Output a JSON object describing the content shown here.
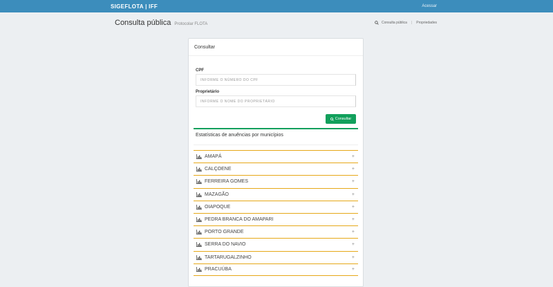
{
  "topbar": {
    "brand": "SIGEFLOTA | IFF",
    "link": "Acessar"
  },
  "header": {
    "title": "Consulta pública",
    "subtitle": "Protocolar FLOTA",
    "links": [
      "Consulta pública",
      "Propriedades"
    ]
  },
  "card": {
    "title": "Consultar",
    "cpf_label": "CPF",
    "cpf_placeholder": "INFORME O NÚMERO DO CPF",
    "owner_label": "Proprietário",
    "owner_placeholder": "INFORME O NOME DO PROPRIETÁRIO",
    "button_label": "Consultar"
  },
  "stats": {
    "title": "Estatísticas de anuências por municípios",
    "municipalities": [
      "AMAPÁ",
      "CALÇOENE",
      "FERREIRA GOMES",
      "MAZAGÃO",
      "OIAPOQUE",
      "PEDRA BRANCA DO AMAPARI",
      "PORTO GRANDE",
      "SERRA DO NAVIO",
      "TARTARUGALZINHO",
      "PRACUÚBA"
    ]
  },
  "colors": {
    "topbar": "#3c8dbc",
    "accent_green": "#12a05c",
    "row_border": "#e6a817"
  }
}
